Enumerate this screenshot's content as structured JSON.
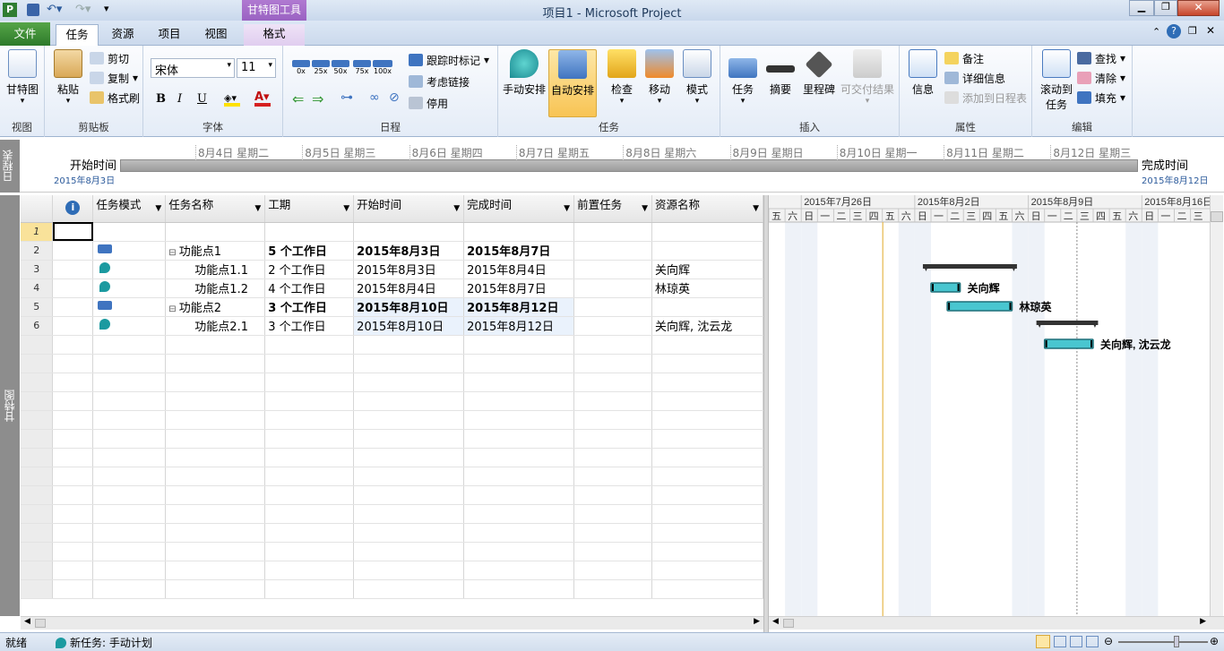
{
  "window": {
    "title": "项目1 - Microsoft Project",
    "context_tab": "甘特图工具"
  },
  "tabs": {
    "file": "文件",
    "task": "任务",
    "resource": "资源",
    "project": "项目",
    "view": "视图",
    "format": "格式"
  },
  "ribbon": {
    "view_group": {
      "gantt": "甘特图",
      "label": "视图"
    },
    "clipboard": {
      "paste": "粘贴",
      "cut": "剪切",
      "copy": "复制",
      "format_painter": "格式刷",
      "label": "剪贴板"
    },
    "font": {
      "font_name": "宋体",
      "font_size": "11",
      "bold": "B",
      "italic": "I",
      "underline": "U",
      "label": "字体"
    },
    "schedule": {
      "pcts": [
        "0x",
        "25x",
        "50x",
        "75x",
        "100x"
      ],
      "track": "跟踪时标记",
      "respect_links": "考虑链接",
      "deactivate": "停用",
      "label": "日程"
    },
    "tasks": {
      "manual": "手动安排",
      "auto": "自动安排",
      "inspect": "检查",
      "move": "移动",
      "mode": "模式",
      "label": "任务"
    },
    "insert": {
      "task": "任务",
      "summary": "摘要",
      "milestone": "里程碑",
      "deliverable": "可交付结果",
      "label": "插入"
    },
    "properties": {
      "info": "信息",
      "notes": "备注",
      "details": "详细信息",
      "add_timeline": "添加到日程表",
      "label": "属性"
    },
    "editing": {
      "scroll_to": "滚动到",
      "scroll_to2": "任务",
      "find": "查找",
      "clear": "清除",
      "fill": "填充",
      "label": "编辑"
    }
  },
  "timeline": {
    "side_label": "日程表",
    "start_label": "开始时间",
    "start_date": "2015年8月3日",
    "finish_label": "完成时间",
    "finish_date": "2015年8月12日",
    "days": [
      "8月4日 星期二",
      "8月5日 星期三",
      "8月6日 星期四",
      "8月7日 星期五",
      "8月8日 星期六",
      "8月9日 星期日",
      "8月10日 星期一",
      "8月11日 星期二",
      "8月12日 星期三"
    ]
  },
  "gantt_side_label": "甘特图",
  "grid": {
    "headers": {
      "info": "i",
      "mode": "任务模式",
      "name": "任务名称",
      "duration": "工期",
      "start": "开始时间",
      "finish": "完成时间",
      "pred": "前置任务",
      "resource": "资源名称"
    },
    "rows": [
      {
        "id": "1",
        "mode": "",
        "name": "",
        "duration": "",
        "start": "",
        "finish": "",
        "pred": "",
        "resource": "",
        "summary": false
      },
      {
        "id": "2",
        "mode": "auto",
        "name": "功能点1",
        "duration": "5 个工作日",
        "start": "2015年8月3日",
        "finish": "2015年8月7日",
        "pred": "",
        "resource": "",
        "summary": true
      },
      {
        "id": "3",
        "mode": "manual",
        "name": "功能点1.1",
        "duration": "2 个工作日",
        "start": "2015年8月3日",
        "finish": "2015年8月4日",
        "pred": "",
        "resource": "关向辉",
        "summary": false
      },
      {
        "id": "4",
        "mode": "manual",
        "name": "功能点1.2",
        "duration": "4 个工作日",
        "start": "2015年8月4日",
        "finish": "2015年8月7日",
        "pred": "",
        "resource": "林琼英",
        "summary": false
      },
      {
        "id": "5",
        "mode": "auto",
        "name": "功能点2",
        "duration": "3 个工作日",
        "start": "2015年8月10日",
        "finish": "2015年8月12日",
        "pred": "",
        "resource": "",
        "summary": true
      },
      {
        "id": "6",
        "mode": "manual",
        "name": "功能点2.1",
        "duration": "3 个工作日",
        "start": "2015年8月10日",
        "finish": "2015年8月12日",
        "pred": "",
        "resource": "关向辉, 沈云龙",
        "summary": false
      }
    ]
  },
  "gantt": {
    "weeks": [
      "2015年7月26日",
      "2015年8月2日",
      "2015年8月9日",
      "2015年8月16日"
    ],
    "days": [
      "五",
      "六",
      "日",
      "一",
      "二",
      "三",
      "四",
      "五",
      "六",
      "日",
      "一",
      "二",
      "三",
      "四",
      "五",
      "六",
      "日",
      "一",
      "二",
      "三",
      "四",
      "五",
      "六",
      "日",
      "一",
      "二",
      "三"
    ],
    "bar_labels": {
      "r3": "关向辉",
      "r4": "林琼英",
      "r6": "关向辉, 沈云龙"
    }
  },
  "status": {
    "ready": "就绪",
    "new_task": "新任务: 手动计划"
  }
}
